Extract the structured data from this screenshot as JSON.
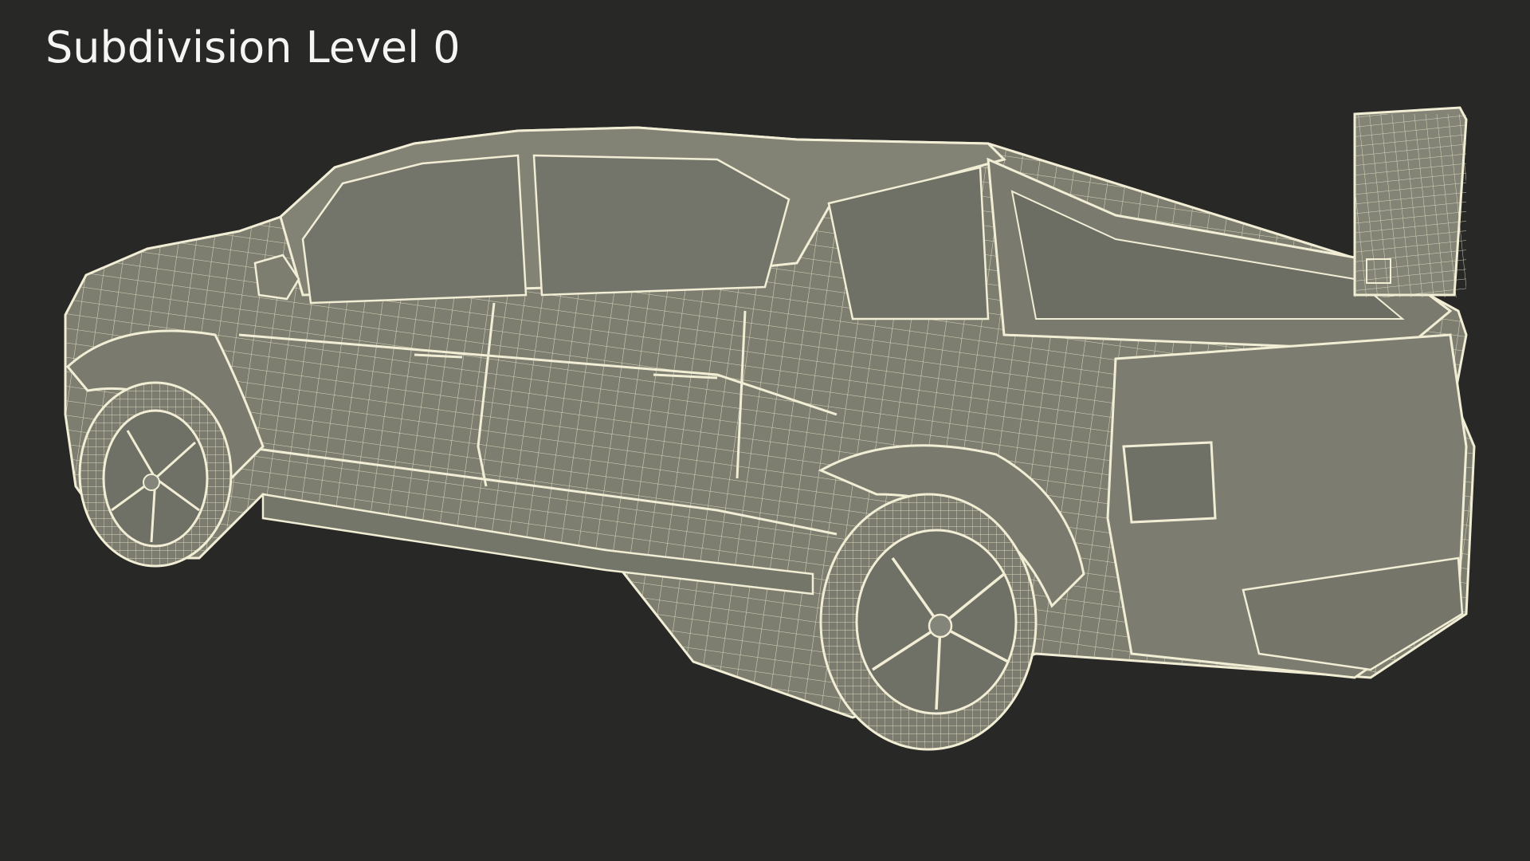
{
  "viewport": {
    "title": "Subdivision Level 0",
    "subject": "pickup-truck-wireframe-model",
    "background_color": "#282827",
    "wire_color": "#f2eed6",
    "surface_color": "#7d7e70"
  }
}
